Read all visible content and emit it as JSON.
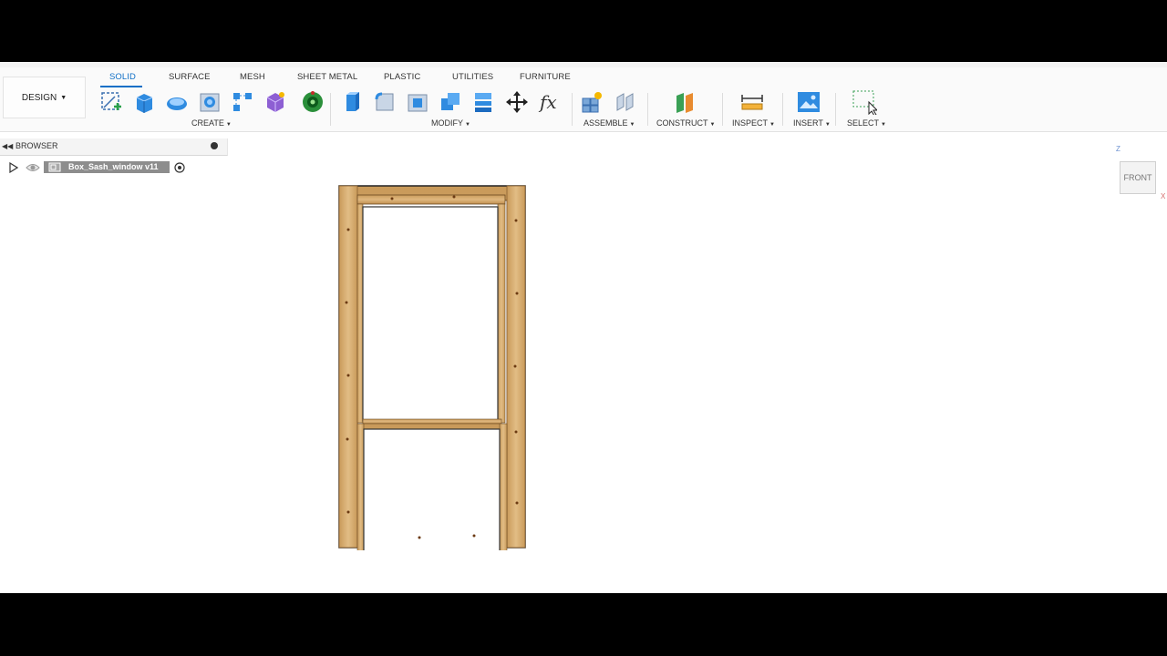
{
  "workspace": {
    "label": "DESIGN"
  },
  "tabs": [
    {
      "label": "SOLID"
    },
    {
      "label": "SURFACE"
    },
    {
      "label": "MESH"
    },
    {
      "label": "SHEET METAL"
    },
    {
      "label": "PLASTIC"
    },
    {
      "label": "UTILITIES"
    },
    {
      "label": "FURNITURE"
    }
  ],
  "groups": {
    "create": "CREATE",
    "modify": "MODIFY",
    "assemble": "ASSEMBLE",
    "construct": "CONSTRUCT",
    "inspect": "INSPECT",
    "insert": "INSERT",
    "select": "SELECT"
  },
  "browser": {
    "title": "BROWSER",
    "root_item": "Box_Sash_window v11"
  },
  "viewcube": {
    "face": "FRONT",
    "axis_z": "Z",
    "axis_x": "X"
  },
  "colors": {
    "accent": "#0f6fc6",
    "wood": "#d8b078"
  }
}
